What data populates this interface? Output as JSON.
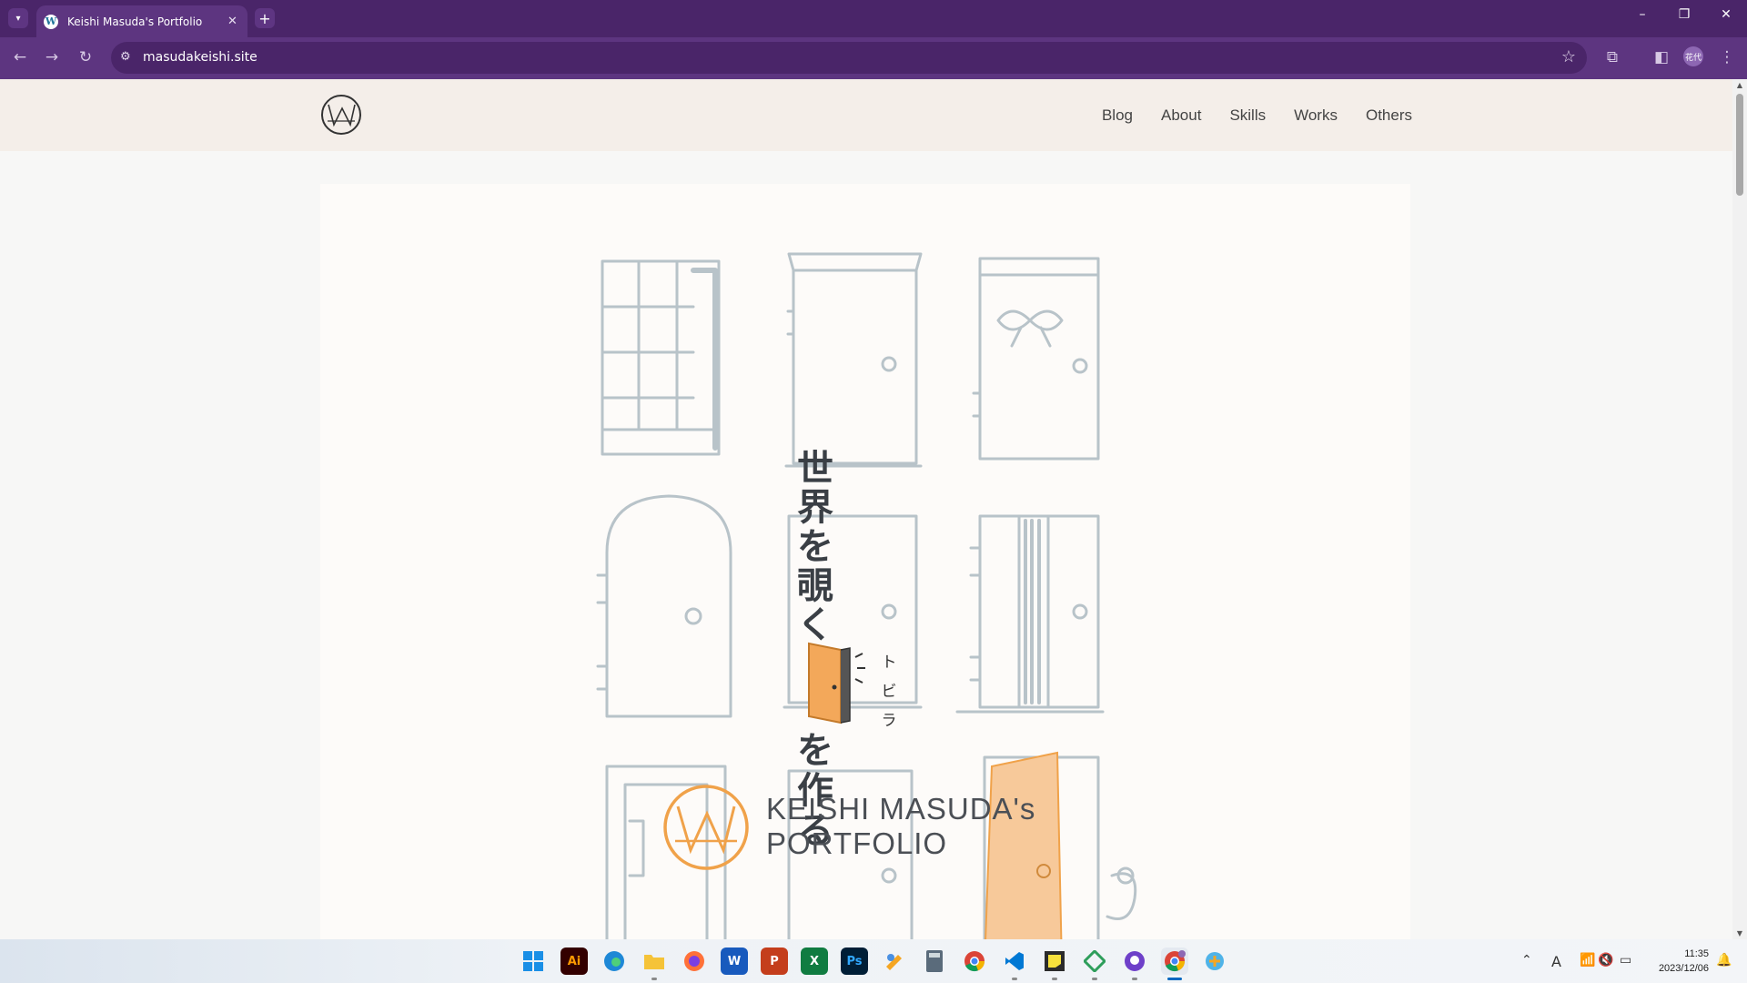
{
  "browser": {
    "tab_title": "Keishi Masuda's Portfolio",
    "url": "masudakeishi.site",
    "profile_label": "花代",
    "icons": {
      "tab_list": "chevron-down-icon",
      "new_tab": "plus-icon",
      "back": "back-arrow-icon",
      "forward": "forward-arrow-icon",
      "reload": "reload-icon",
      "site_info": "site-settings-icon",
      "bookmark": "star-icon",
      "extensions": "puzzle-icon",
      "side_panel": "side-panel-icon",
      "menu": "kebab-menu-icon"
    }
  },
  "site": {
    "nav": [
      "Blog",
      "About",
      "Skills",
      "Works",
      "Others"
    ],
    "hero": {
      "catch_top": [
        "世",
        "界",
        "を",
        "覗",
        "く"
      ],
      "ruby": [
        "ト",
        "ビ",
        "ラ"
      ],
      "catch_bottom": [
        "を",
        "作",
        "る"
      ],
      "brand_line1": "KEISHI MASUDA's",
      "brand_line2": "PORTFOLIO"
    },
    "colors": {
      "header_bg": "#f4eee9",
      "hero_bg": "#fdfbf9",
      "accent_orange": "#f0a24a",
      "door_sketch": "#b8c3c9",
      "browser_purple": "#4a2569"
    }
  },
  "taskbar": {
    "apps": [
      "windows-start",
      "adobe-illustrator",
      "edge",
      "file-explorer",
      "firefox",
      "word",
      "powerpoint",
      "excel",
      "photoshop",
      "paint",
      "calculator",
      "chrome",
      "vscode",
      "sticky-notes",
      "app-green",
      "github-desktop",
      "chrome-profile",
      "app-blue"
    ],
    "illustrator_label": "Ai",
    "photoshop_label": "Ps",
    "word_label": "W",
    "powerpoint_label": "P",
    "excel_label": "X",
    "ime_label": "A",
    "time": "11:35",
    "date": "2023/12/06"
  }
}
